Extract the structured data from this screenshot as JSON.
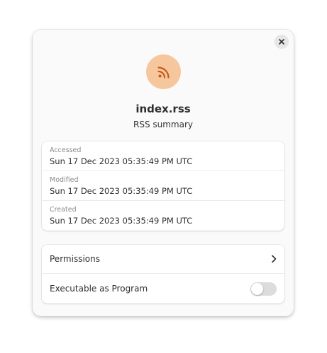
{
  "file": {
    "icon": "rss-feed-icon",
    "icon_bg_color": "#f6c79d",
    "icon_fg_color": "#c95a1b",
    "name": "index.rss",
    "type": "RSS summary"
  },
  "dates": [
    {
      "label": "Accessed",
      "value": "Sun 17 Dec 2023 05:35:49 PM UTC"
    },
    {
      "label": "Modified",
      "value": "Sun 17 Dec 2023 05:35:49 PM UTC"
    },
    {
      "label": "Created",
      "value": "Sun 17 Dec 2023 05:35:49 PM UTC"
    }
  ],
  "permissions": {
    "label": "Permissions",
    "chevron_icon": "chevron-right-icon"
  },
  "executable": {
    "label": "Executable as Program",
    "enabled": false
  },
  "close_icon": "close-icon"
}
